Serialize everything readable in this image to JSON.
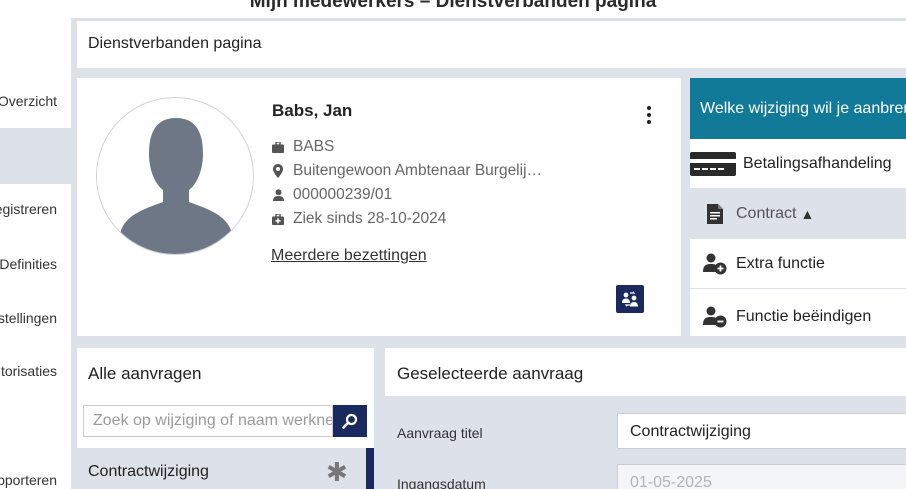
{
  "top": {
    "title": "Mijn medewerkers – Dienstverbanden pagina"
  },
  "sidebar": {
    "items": [
      {
        "label": "Overzicht"
      },
      {
        "label": ""
      },
      {
        "label": "Registreren"
      },
      {
        "label": "Definities"
      },
      {
        "label": "Instellingen"
      },
      {
        "label": "Autorisaties"
      },
      {
        "label": ""
      },
      {
        "label": "Rapporteren"
      }
    ]
  },
  "page": {
    "title": "Dienstverbanden pagina"
  },
  "profile": {
    "name": "Babs, Jan",
    "company": "BABS",
    "function": "Buitengewoon Ambtenaar Burgelij…",
    "employee_number": "000000239/01",
    "sick_status": "Ziek sinds 28-10-2024",
    "link": "Meerdere bezettingen"
  },
  "changes": {
    "header": "Welke wijziging wil je aanbrengen?",
    "options": [
      {
        "label": "Betalingsafhandeling",
        "icon": "payment-card-icon"
      },
      {
        "label": "Contract",
        "icon": "document-icon",
        "warning": "▲"
      },
      {
        "label": "Extra functie",
        "icon": "user-add-icon"
      },
      {
        "label": "Functie beëindigen",
        "icon": "user-remove-icon"
      }
    ]
  },
  "requests": {
    "header": "Alle aanvragen",
    "search_placeholder": "Zoek op wijziging of naam werknemer",
    "items": [
      {
        "title": "Contractwijziging",
        "marker": "✱"
      }
    ]
  },
  "selected": {
    "header": "Geselecteerde aanvraag",
    "fields": [
      {
        "label": "Aanvraag titel",
        "value": "Contractwijziging"
      },
      {
        "label": "Ingangsdatum",
        "value": "01-05-2025"
      }
    ]
  },
  "colors": {
    "navy": "#1b2a5e",
    "teal": "#117a99",
    "panel_bg": "#dde1ea"
  }
}
